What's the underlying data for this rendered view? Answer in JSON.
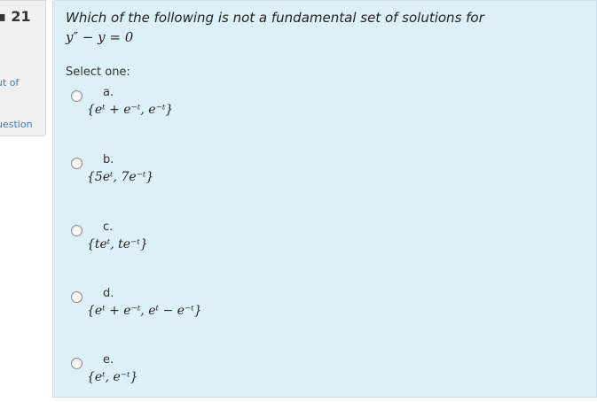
{
  "info": {
    "question_number": "21",
    "marks_fragment": "ut of",
    "flag_fragment": "uestion"
  },
  "question": {
    "text": "Which of the following is not a fundamental set of solutions for",
    "equation": "y″ − y = 0",
    "prompt": "Select one:"
  },
  "options": [
    {
      "letter": "a.",
      "formula": "{eᵗ + e⁻ᵗ, e⁻ᵗ}"
    },
    {
      "letter": "b.",
      "formula": "{5eᵗ, 7e⁻ᵗ}"
    },
    {
      "letter": "c.",
      "formula": "{teᵗ, te⁻ᵗ}"
    },
    {
      "letter": "d.",
      "formula": "{eᵗ + e⁻ᵗ, eᵗ − e⁻ᵗ}"
    },
    {
      "letter": "e.",
      "formula": "{eᵗ, e⁻ᵗ}"
    }
  ]
}
